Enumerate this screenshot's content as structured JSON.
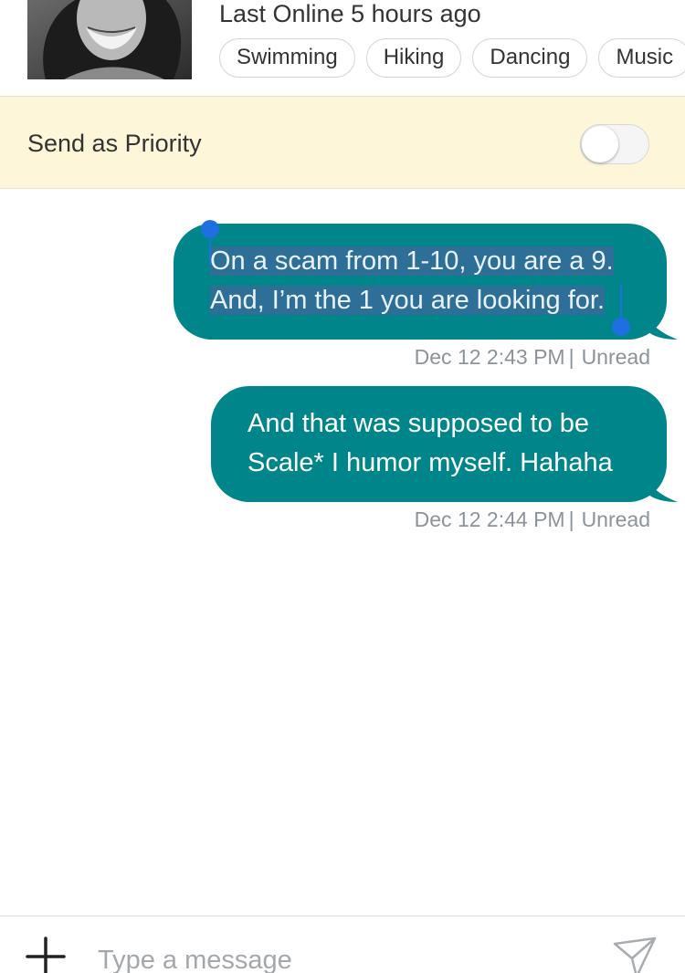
{
  "profile": {
    "last_online": "Last Online 5 hours ago",
    "tags": [
      "Swimming",
      "Hiking",
      "Dancing",
      "Music"
    ]
  },
  "priority": {
    "label": "Send as Priority",
    "enabled": false
  },
  "messages": [
    {
      "lines": [
        "On a scam from 1-10, you are a 9.",
        "And, I’m the 1 you are looking for."
      ],
      "timestamp": "Dec 12 2:43 PM",
      "status": "Unread",
      "selected": true
    },
    {
      "lines": [
        "And that was supposed to be",
        "Scale* I humor myself. Hahaha"
      ],
      "timestamp": "Dec 12 2:44 PM",
      "status": "Unread",
      "selected": false
    }
  ],
  "composer": {
    "placeholder": "Type a message",
    "value": ""
  },
  "icons": {
    "add": "plus-icon",
    "send": "send-icon"
  },
  "colors": {
    "bubble": "#00868a",
    "priority_bar": "#fdf6d8",
    "selection": "#2d6f97",
    "selection_handle": "#1f6fe0"
  }
}
